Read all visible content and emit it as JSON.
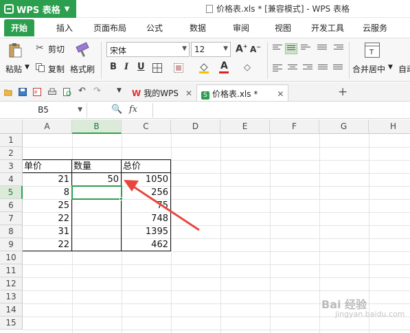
{
  "app": {
    "button_label": "WPS 表格",
    "window_title": "价格表.xls * [兼容模式] - WPS 表格"
  },
  "tabs": [
    "开始",
    "插入",
    "页面布局",
    "公式",
    "数据",
    "审阅",
    "视图",
    "开发工具",
    "云服务"
  ],
  "ribbon": {
    "paste": "粘贴",
    "cut": "剪切",
    "copy": "复制",
    "format_painter": "格式刷",
    "font_name": "宋体",
    "font_size": "12",
    "merge_center": "合并居中",
    "auto_wrap": "自动"
  },
  "doc_tabs": {
    "home": "我的WPS",
    "file": "价格表.xls *"
  },
  "formula_bar": {
    "name_box": "B5",
    "fx": "fx",
    "content": ""
  },
  "columns": [
    "A",
    "B",
    "C",
    "D",
    "E",
    "F",
    "G",
    "H"
  ],
  "rows": [
    "1",
    "2",
    "3",
    "4",
    "5",
    "6",
    "7",
    "8",
    "9",
    "10",
    "11",
    "12",
    "13",
    "14",
    "15"
  ],
  "table": {
    "headers": [
      "单价",
      "数量",
      "总价"
    ],
    "rows": [
      {
        "price": "21",
        "qty": "50",
        "total": "1050"
      },
      {
        "price": "8",
        "qty": "",
        "total": "256"
      },
      {
        "price": "25",
        "qty": "",
        "total": "75"
      },
      {
        "price": "22",
        "qty": "",
        "total": "748"
      },
      {
        "price": "31",
        "qty": "",
        "total": "1395"
      },
      {
        "price": "22",
        "qty": "",
        "total": "462"
      }
    ]
  },
  "selected_cell": "B5",
  "colors": {
    "accent": "#2b9f4e",
    "arrow": "#e8463c"
  },
  "watermark": {
    "line1": "Bai 经验",
    "line2": "jingyan.baidu.com"
  }
}
